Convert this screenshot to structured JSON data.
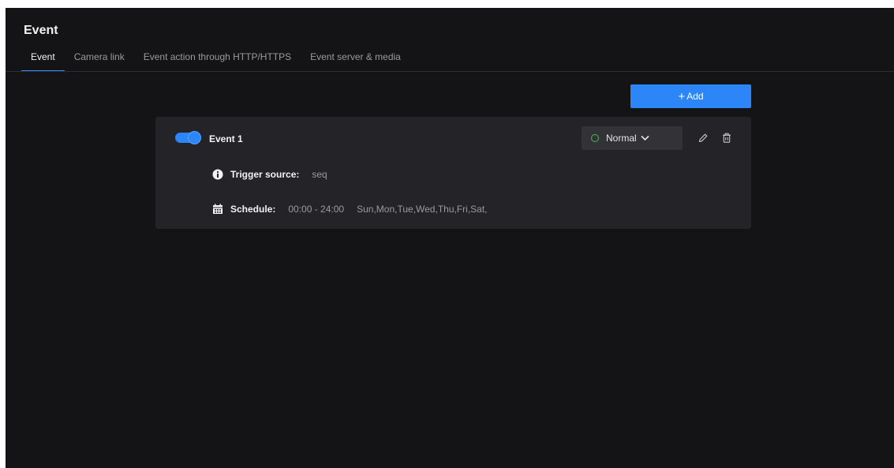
{
  "page": {
    "title": "Event"
  },
  "tabs": [
    {
      "label": "Event",
      "active": true
    },
    {
      "label": "Camera link",
      "active": false
    },
    {
      "label": "Event action through HTTP/HTTPS",
      "active": false
    },
    {
      "label": "Event server & media",
      "active": false
    }
  ],
  "toolbar": {
    "add_label": "Add",
    "add_icon": "plus-icon"
  },
  "event": {
    "name": "Event 1",
    "enabled": true,
    "status": "Normal",
    "trigger_label": "Trigger source:",
    "trigger_value": "seq",
    "schedule_label": "Schedule:",
    "schedule_time": "00:00 - 24:00",
    "schedule_days": "Sun,Mon,Tue,Wed,Thu,Fri,Sat,"
  },
  "colors": {
    "accent": "#2d86f7",
    "background": "#141416",
    "card": "#242428",
    "status_ok": "#3cc23c"
  },
  "icons": {
    "edit": "pencil-icon",
    "delete": "trash-icon",
    "info": "info-icon",
    "schedule": "calendar-icon",
    "dropdown": "chevron-down-icon"
  }
}
